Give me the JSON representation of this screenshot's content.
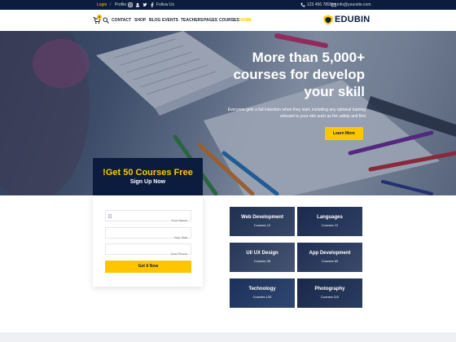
{
  "topbar": {
    "login": "Login",
    "profile": "Profile",
    "follow": "Follow Us",
    "phone": "123 456 7890",
    "email": "info@yoursite.com"
  },
  "nav": {
    "items": [
      "CONTACT",
      "SHOP",
      "BLOG",
      "EVENTS",
      "TEACHERS",
      "PAGES",
      "COURSES",
      "HOME"
    ],
    "active": "HOME",
    "cart_count": "0",
    "logo_text": "EDUBIN"
  },
  "hero": {
    "title_line1": "More than 5,000+",
    "title_line2": "courses for develop",
    "title_line3": "your skill",
    "description": "Everyone gets a full induction when they start, including any optional training relevant to your role such as fire safety and first",
    "button": "Learn More"
  },
  "signup": {
    "title": "!Get 50 Courses Free",
    "subtitle": "Sign Up Now",
    "name_placeholder": "Your Name",
    "mail_placeholder": "Your Mail",
    "phone_placeholder": "Your Phone",
    "button": "Get It Now"
  },
  "courses": [
    {
      "name": "Web Development",
      "count": "Courses 12"
    },
    {
      "name": "Languages",
      "count": "Courses 12"
    },
    {
      "name": "UI/ UX Design",
      "count": "Courses 35"
    },
    {
      "name": "App Development",
      "count": "Courses 60"
    },
    {
      "name": "Technology",
      "count": "Courses 120"
    },
    {
      "name": "Photography",
      "count": "Courses 110"
    }
  ],
  "colors": {
    "navy": "#0b1c3f",
    "accent": "#ffc600"
  }
}
